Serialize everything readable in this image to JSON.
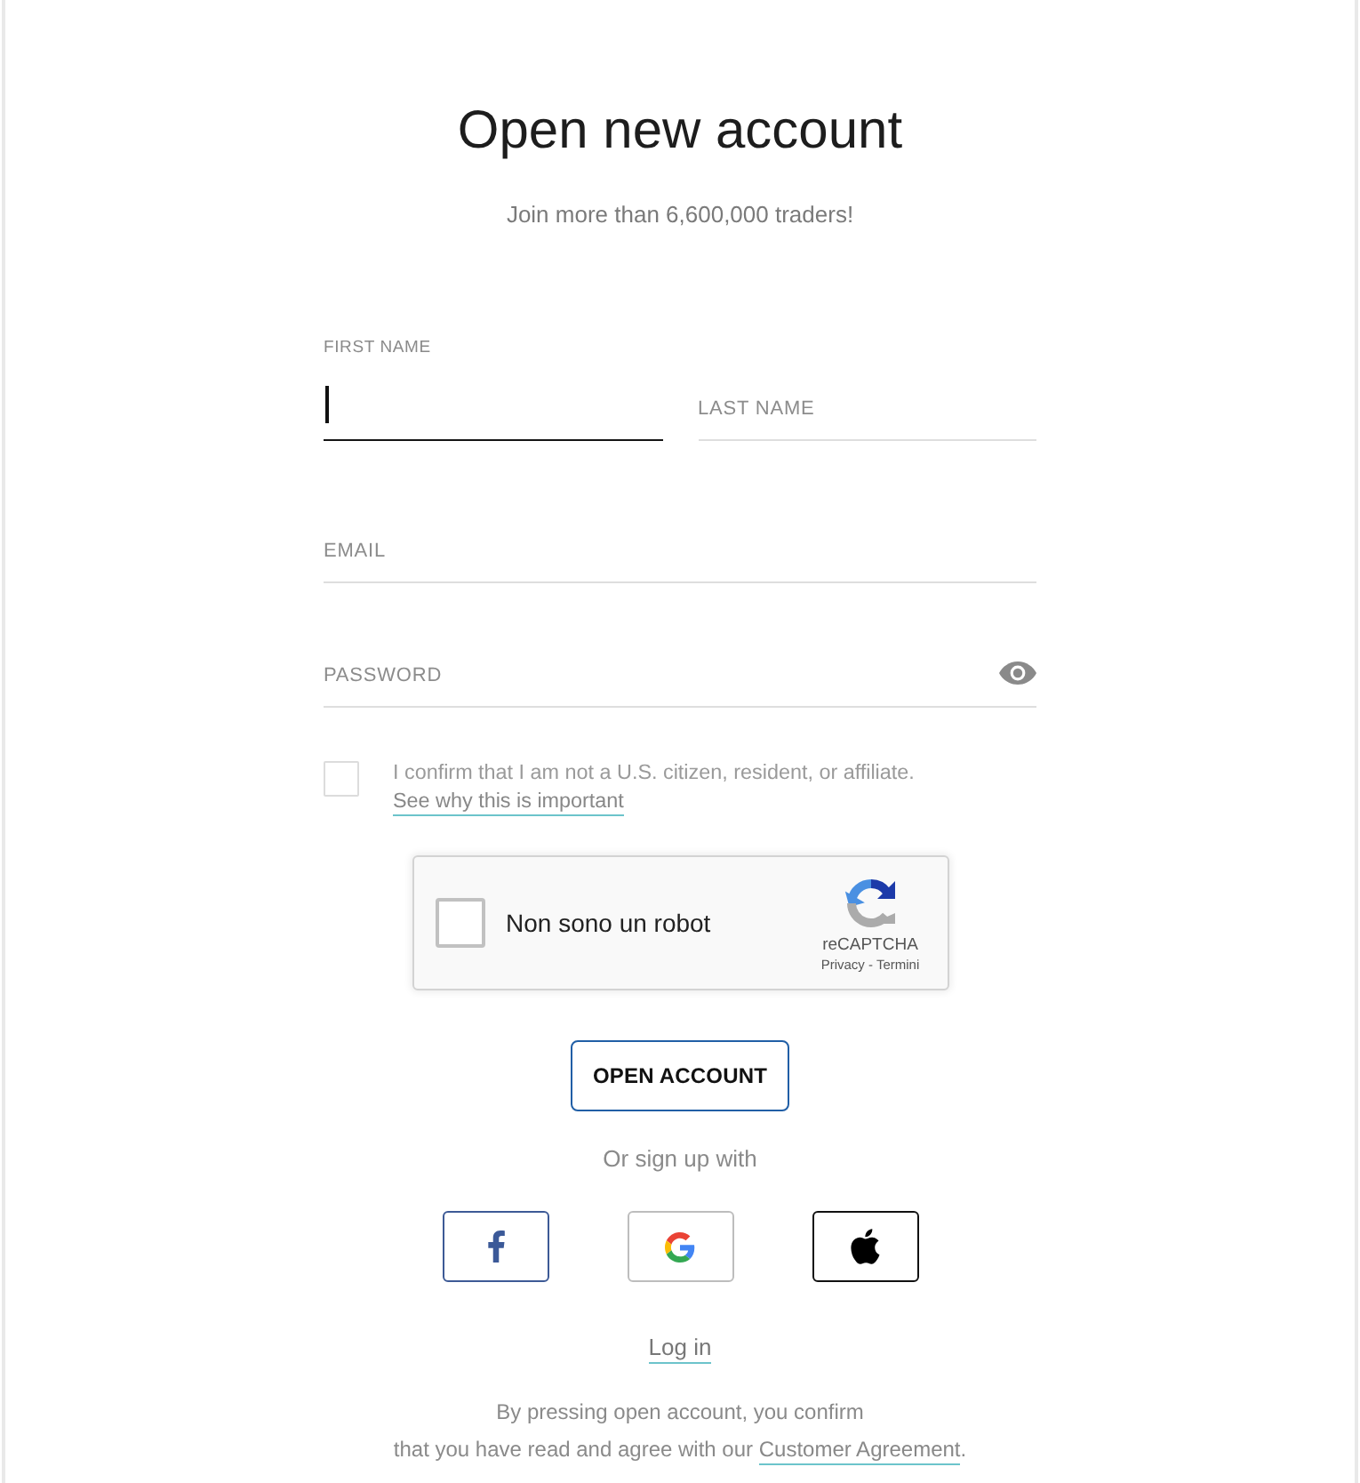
{
  "title": "Open new account",
  "subtitle": "Join more than 6,600,000 traders!",
  "name_fields": [
    {
      "label": "FIRST NAME",
      "focused": true
    },
    {
      "placeholder": "LAST NAME",
      "focused": false
    }
  ],
  "fields": [
    {
      "kind": "text",
      "placeholder": "EMAIL",
      "focused": false
    },
    {
      "kind": "password",
      "placeholder": "PASSWORD",
      "focused": false
    }
  ],
  "us_confirmation": {
    "checked": false,
    "text": "I confirm that I am not a U.S. citizen, resident, or affiliate.",
    "link": "See why this is important"
  },
  "captcha": {
    "checked": false,
    "label": "Non sono un robot",
    "brand": "reCAPTCHA",
    "links": "Privacy - Termini"
  },
  "submit": "OPEN ACCOUNT",
  "social_heading": "Or sign up with",
  "social_buttons": [
    {
      "kind": "facebook"
    },
    {
      "kind": "google"
    },
    {
      "kind": "apple"
    }
  ],
  "login_link": "Log in",
  "agreement": {
    "line_1": "By pressing open account, you confirm",
    "line_2": "that you have read and agree with our",
    "link": "Customer Agreement",
    "after_link": "."
  }
}
